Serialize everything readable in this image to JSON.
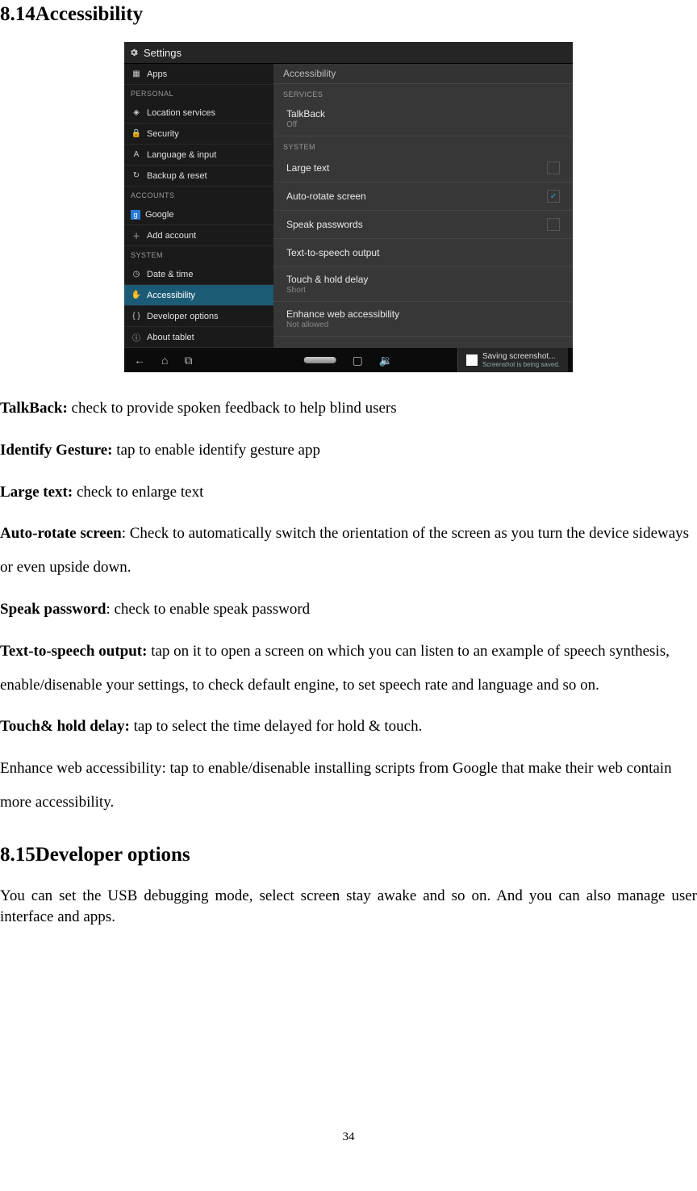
{
  "headings": {
    "h814": "8.14Accessibility",
    "h815": "8.15Developer options"
  },
  "paragraphs": {
    "talkback_b": "TalkBack:",
    "talkback_t": " check to provide spoken feedback to help blind users",
    "identify_b": "Identify Gesture:",
    "identify_t": " tap to enable identify gesture app",
    "largetext_b": "Large text:",
    "largetext_t": " check to enlarge text",
    "autorotate_b": "Auto-rotate screen",
    "autorotate_t": ": Check to automatically switch the orientation of the screen as you turn the device sideways or even upside down.",
    "speakpw_b": "Speak password",
    "speakpw_t": ": check to enable speak password",
    "tts_b": "Text-to-speech output:",
    "tts_t": " tap on it to open a screen on which you can listen to an example of speech synthesis, enable/disenable your settings, to check default engine, to set speech rate and language and so on.",
    "touch_b": "Touch& hold delay:",
    "touch_t": " tap to select the time delayed for hold & touch.",
    "enhance_t": "Enhance web accessibility: tap to enable/disenable installing scripts from Google that make their web contain more accessibility.",
    "dev_t": "You can set the USB debugging mode, select screen stay awake and so on. And you can also manage user interface and apps."
  },
  "page_number": "34",
  "screenshot": {
    "title": "Settings",
    "sidebar": {
      "items_top": [
        {
          "icon": "▦",
          "label": "Apps"
        }
      ],
      "header_personal": "PERSONAL",
      "items_personal": [
        {
          "icon": "◈",
          "label": "Location services"
        },
        {
          "icon": "🔒",
          "label": "Security"
        },
        {
          "icon": "A",
          "label": "Language & input"
        },
        {
          "icon": "↻",
          "label": "Backup & reset"
        }
      ],
      "header_accounts": "ACCOUNTS",
      "items_accounts": [
        {
          "icon": "g",
          "label": "Google"
        },
        {
          "icon": "＋",
          "label": "Add account"
        }
      ],
      "header_system": "SYSTEM",
      "items_system": [
        {
          "icon": "◷",
          "label": "Date & time"
        },
        {
          "icon": "✋",
          "label": "Accessibility"
        },
        {
          "icon": "{ }",
          "label": "Developer options"
        },
        {
          "icon": "ⓘ",
          "label": "About tablet"
        }
      ]
    },
    "content": {
      "header": "Accessibility",
      "section_services": "SERVICES",
      "talkback": "TalkBack",
      "talkback_sub": "Off",
      "section_system": "SYSTEM",
      "large_text": "Large text",
      "auto_rotate": "Auto-rotate screen",
      "speak_passwords": "Speak passwords",
      "tts": "Text-to-speech output",
      "touch_hold": "Touch & hold delay",
      "touch_hold_sub": "Short",
      "enhance": "Enhance web accessibility",
      "enhance_sub": "Not allowed",
      "checkmark": "✓"
    },
    "navbar": {
      "back": "←",
      "home": "⌂",
      "recent": "⧉",
      "toast_title": "Saving screenshot...",
      "toast_sub": "Screenshot is being saved."
    }
  }
}
